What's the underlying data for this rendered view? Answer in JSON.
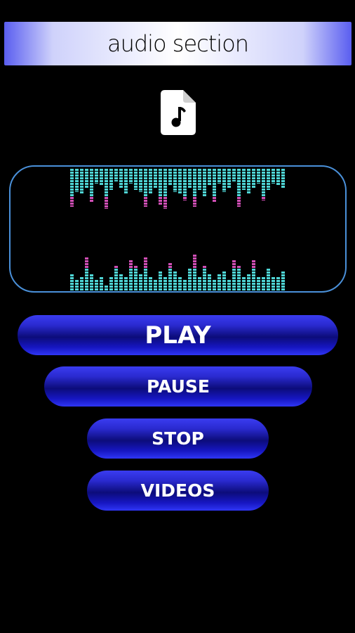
{
  "header": {
    "title": "audio section"
  },
  "icons": {
    "file": "audio-file-icon"
  },
  "visualizer": {
    "top_levels": [
      0.9,
      0.55,
      0.6,
      0.45,
      0.8,
      0.35,
      0.4,
      0.95,
      0.5,
      0.3,
      0.45,
      0.6,
      0.35,
      0.5,
      0.55,
      0.9,
      0.6,
      0.45,
      0.85,
      0.95,
      0.4,
      0.55,
      0.6,
      0.75,
      0.45,
      0.9,
      0.5,
      0.65,
      0.4,
      0.8,
      0.35,
      0.55,
      0.45,
      0.3,
      0.9,
      0.5,
      0.6,
      0.45,
      0.35,
      0.75,
      0.5,
      0.35,
      0.4,
      0.45
    ],
    "bottom_levels": [
      0.35,
      0.2,
      0.3,
      0.7,
      0.35,
      0.2,
      0.3,
      0.1,
      0.3,
      0.5,
      0.35,
      0.25,
      0.65,
      0.5,
      0.35,
      0.7,
      0.25,
      0.2,
      0.4,
      0.3,
      0.6,
      0.4,
      0.3,
      0.2,
      0.45,
      0.75,
      0.3,
      0.5,
      0.35,
      0.2,
      0.35,
      0.4,
      0.2,
      0.65,
      0.55,
      0.3,
      0.35,
      0.65,
      0.3,
      0.25,
      0.45,
      0.25,
      0.3,
      0.4
    ],
    "colors": {
      "teal": "#4fd6d6",
      "magenta": "#d04fb5",
      "frame": "#4a90d9"
    }
  },
  "buttons": {
    "play": "PLAY",
    "pause": "PAUSE",
    "stop": "STOP",
    "videos": "VIDEOS"
  }
}
